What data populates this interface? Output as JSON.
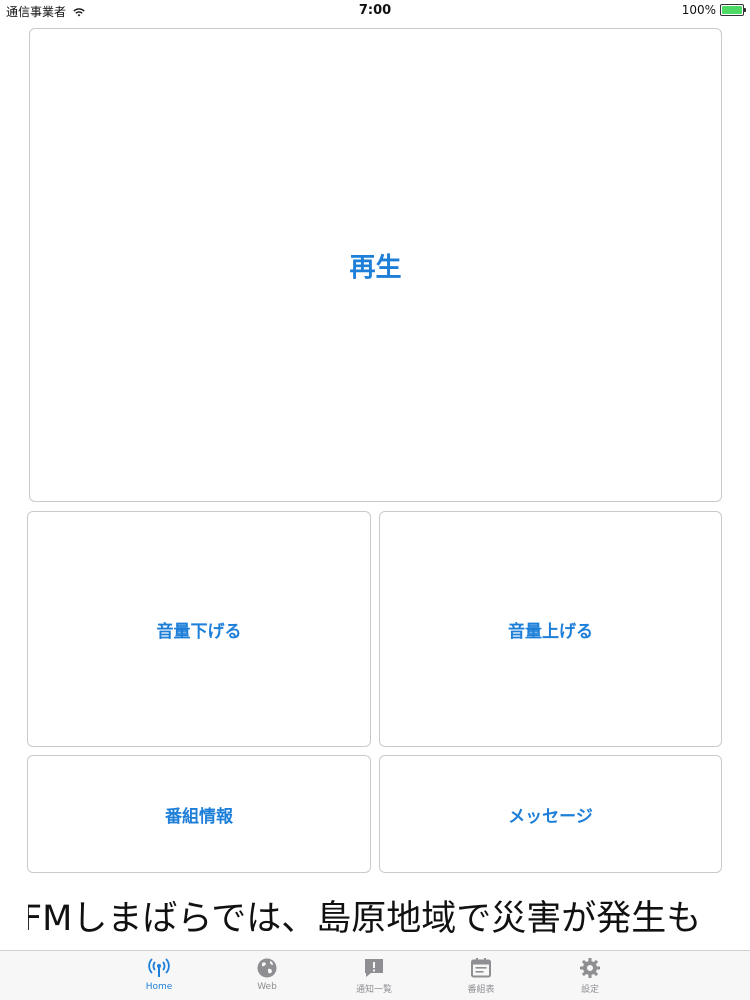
{
  "status_bar": {
    "carrier": "通信事業者",
    "time": "7:00",
    "battery_text": "100%",
    "battery_level": 1.0,
    "battery_color": "#4cd964"
  },
  "controls": {
    "play_label": "再生",
    "volume_down_label": "音量下げる",
    "volume_up_label": "音量上げる",
    "program_info_label": "番組情報",
    "message_label": "メッセージ"
  },
  "ticker": {
    "text": "FMしまばらでは、島原地域で災害が発生も"
  },
  "tabbar": {
    "items": [
      {
        "label": "Home",
        "icon": "radio-signal-icon",
        "active": true
      },
      {
        "label": "Web",
        "icon": "globe-icon",
        "active": false
      },
      {
        "label": "通知一覧",
        "icon": "notification-icon",
        "active": false
      },
      {
        "label": "番組表",
        "icon": "calendar-icon",
        "active": false
      },
      {
        "label": "設定",
        "icon": "gear-icon",
        "active": false
      }
    ]
  },
  "colors": {
    "accent": "#1e7fd8",
    "inactive": "#8e8e93"
  }
}
